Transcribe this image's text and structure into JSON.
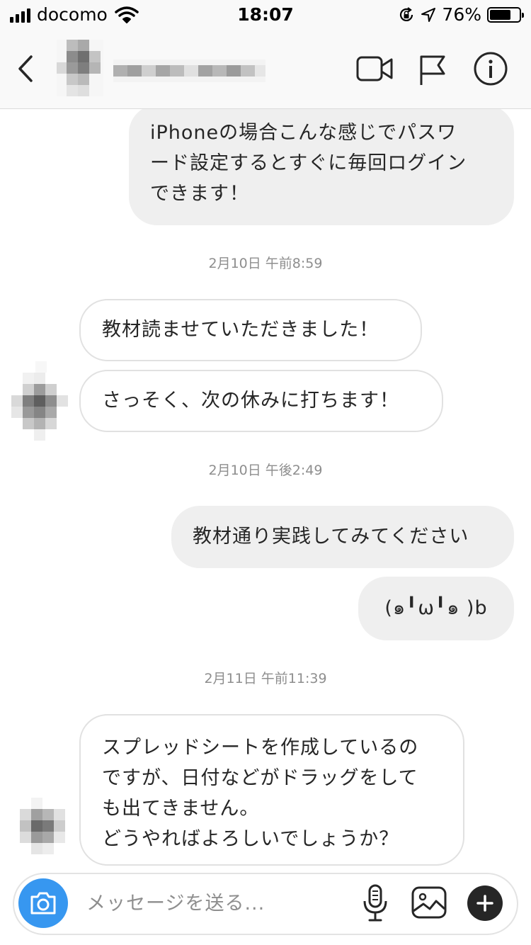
{
  "status_bar": {
    "carrier": "docomo",
    "time": "18:07",
    "battery_percent_label": "76%",
    "battery_level": 0.76,
    "icons": [
      "signal-bars-icon",
      "wifi-icon",
      "rotation-lock-icon",
      "location-arrow-icon",
      "battery-icon"
    ]
  },
  "nav": {
    "icons": [
      "chevron-left-icon",
      "video-camera-icon",
      "flag-icon",
      "info-icon"
    ]
  },
  "messages": [
    {
      "direction": "outgoing",
      "text": "iPhoneの場合こんな感じでパスワ\nード設定するとすぐに毎回ログイン\nできます！"
    },
    {
      "type": "timestamp",
      "text": "2月10日 午前8:59"
    },
    {
      "direction": "incoming",
      "text": "教材読ませていただきました！"
    },
    {
      "direction": "incoming",
      "text": "さっそく、次の休みに打ちます！"
    },
    {
      "type": "timestamp",
      "text": "2月10日 午後2:49"
    },
    {
      "direction": "outgoing",
      "text": "教材通り実践してみてください"
    },
    {
      "direction": "outgoing",
      "text": "(๑╹ω╹๑ )b"
    },
    {
      "type": "timestamp",
      "text": "2月11日 午前11:39"
    },
    {
      "direction": "incoming",
      "text": "スプレッドシートを作成しているの\nですが、日付などがドラッグをして\nも出てきません。\nどうやればよろしいでしょうか？"
    }
  ],
  "composer": {
    "placeholder": "メッセージを送る...",
    "icons": [
      "camera-icon",
      "microphone-icon",
      "image-gallery-icon",
      "plus-icon"
    ]
  },
  "colors": {
    "bar_background": "#f9f9f9",
    "outgoing_bubble": "#efefef",
    "incoming_bubble_border": "#e1e1e1",
    "timestamp": "#8e8e8e",
    "camera_button": "#3797f0",
    "text": "#262626"
  }
}
